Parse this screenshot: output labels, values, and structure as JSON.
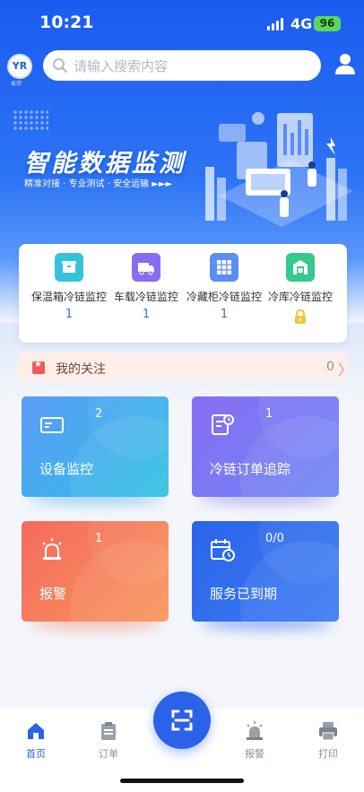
{
  "status_bar": {
    "time": "10:21",
    "network": "4G",
    "battery": "96"
  },
  "header": {
    "logo_text": "YR",
    "logo_sub": "易然",
    "search_placeholder": "请输入搜索内容"
  },
  "banner": {
    "title": "智能数据监测",
    "subtitle": "精准对接 · 专业测试 · 安全运输 ►►►"
  },
  "categories": [
    {
      "label": "保温箱冷链监控",
      "count": "1",
      "icon": "box-icon",
      "color": "#35c3dc"
    },
    {
      "label": "车载冷链监控",
      "count": "1",
      "icon": "truck-icon",
      "color": "#8a6cf0"
    },
    {
      "label": "冷藏柜冷链监控",
      "count": "1",
      "icon": "cabinet-icon",
      "color": "#5b8ef6"
    },
    {
      "label": "冷库冷链监控",
      "count": "",
      "icon": "warehouse-icon",
      "color": "#35c98d",
      "locked": true
    }
  ],
  "follow": {
    "label": "我的关注",
    "count": "0",
    "chevron": "〉"
  },
  "tiles": [
    {
      "label": "设备监控",
      "count": "2",
      "icon": "device-icon",
      "gradient": [
        "#5b9bf7",
        "#2ec1e3"
      ]
    },
    {
      "label": "冷链订单追踪",
      "count": "1",
      "icon": "order-track-icon",
      "gradient": [
        "#8a6df2",
        "#6b86f7"
      ]
    },
    {
      "label": "报警",
      "count": "1",
      "icon": "alarm-icon",
      "gradient": [
        "#f46b5f",
        "#f9955a"
      ]
    },
    {
      "label": "服务已到期",
      "count": "0/0",
      "icon": "calendar-icon",
      "gradient": [
        "#2a65ea",
        "#3b7bf2"
      ]
    }
  ],
  "nav": [
    {
      "label": "首页",
      "icon": "home-icon",
      "active": true
    },
    {
      "label": "订单",
      "icon": "clipboard-icon",
      "active": false
    },
    {
      "label": "报警",
      "icon": "siren-icon",
      "active": false
    },
    {
      "label": "打印",
      "icon": "printer-icon",
      "active": false
    }
  ],
  "colors": {
    "primary": "#2a62e8",
    "follow_bg": "#fdeee9",
    "lock": "#f5c542"
  }
}
